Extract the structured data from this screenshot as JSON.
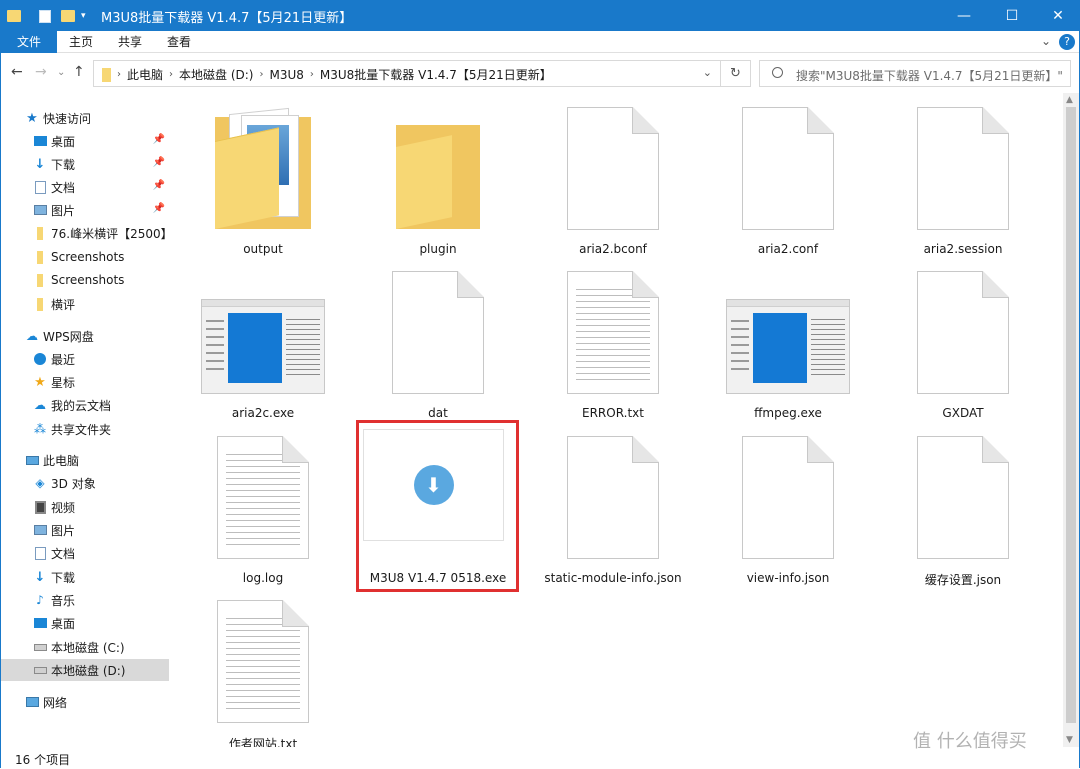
{
  "window": {
    "title": "M3U8批量下载器 V1.4.7【5月21日更新】",
    "controls": {
      "minimize": "—",
      "maximize": "☐",
      "close": "✕"
    }
  },
  "ribbon": {
    "tabs": [
      "文件",
      "主页",
      "共享",
      "查看"
    ],
    "expand_icon": "chevron-down-icon",
    "help_icon": "help-icon"
  },
  "address": {
    "crumbs": [
      "此电脑",
      "本地磁盘 (D:)",
      "M3U8",
      "M3U8批量下载器 V1.4.7【5月21日更新】"
    ],
    "search_placeholder": "搜索\"M3U8批量下载器 V1.4.7【5月21日更新】\""
  },
  "sidebar": {
    "items": [
      {
        "label": "快速访问",
        "icon": "star-icon",
        "pinned": false
      },
      {
        "label": "桌面",
        "icon": "desktop-icon",
        "pinned": true
      },
      {
        "label": "下载",
        "icon": "download-icon",
        "pinned": true
      },
      {
        "label": "文档",
        "icon": "document-icon",
        "pinned": true
      },
      {
        "label": "图片",
        "icon": "pictures-icon",
        "pinned": true
      },
      {
        "label": "76.峰米横评【2500】",
        "icon": "folder-icon",
        "pinned": false
      },
      {
        "label": "Screenshots",
        "icon": "folder-icon",
        "pinned": false
      },
      {
        "label": "Screenshots",
        "icon": "folder-icon",
        "pinned": false
      },
      {
        "label": "横评",
        "icon": "folder-icon",
        "pinned": false
      },
      {
        "label": "WPS网盘",
        "icon": "cloud-icon",
        "pinned": false
      },
      {
        "label": "最近",
        "icon": "clock-icon",
        "pinned": false
      },
      {
        "label": "星标",
        "icon": "star-icon",
        "pinned": false
      },
      {
        "label": "我的云文档",
        "icon": "cloud-icon",
        "pinned": false
      },
      {
        "label": "共享文件夹",
        "icon": "share-icon",
        "pinned": false
      },
      {
        "label": "此电脑",
        "icon": "computer-icon",
        "pinned": false
      },
      {
        "label": "3D 对象",
        "icon": "cube-icon",
        "pinned": false
      },
      {
        "label": "视频",
        "icon": "video-icon",
        "pinned": false
      },
      {
        "label": "图片",
        "icon": "pictures-icon",
        "pinned": false
      },
      {
        "label": "文档",
        "icon": "document-icon",
        "pinned": false
      },
      {
        "label": "下载",
        "icon": "download-icon",
        "pinned": false
      },
      {
        "label": "音乐",
        "icon": "music-icon",
        "pinned": false
      },
      {
        "label": "桌面",
        "icon": "desktop-icon",
        "pinned": false
      },
      {
        "label": "本地磁盘 (C:)",
        "icon": "drive-icon",
        "pinned": false
      },
      {
        "label": "本地磁盘 (D:)",
        "icon": "drive-icon",
        "pinned": false,
        "selected": true
      },
      {
        "label": "网络",
        "icon": "network-icon",
        "pinned": false
      }
    ]
  },
  "files": [
    {
      "name": "output",
      "kind": "folder-docs"
    },
    {
      "name": "plugin",
      "kind": "folder"
    },
    {
      "name": "aria2.bconf",
      "kind": "blank"
    },
    {
      "name": "aria2.conf",
      "kind": "blank"
    },
    {
      "name": "aria2.session",
      "kind": "blank"
    },
    {
      "name": "aria2c.exe",
      "kind": "exe"
    },
    {
      "name": "dat",
      "kind": "blank"
    },
    {
      "name": "ERROR.txt",
      "kind": "text"
    },
    {
      "name": "ffmpeg.exe",
      "kind": "exe"
    },
    {
      "name": "GXDAT",
      "kind": "blank"
    },
    {
      "name": "log.log",
      "kind": "text"
    },
    {
      "name": "M3U8 V1.4.7 0518.exe",
      "kind": "setup",
      "highlighted": true
    },
    {
      "name": "static-module-info.json",
      "kind": "blank"
    },
    {
      "name": "view-info.json",
      "kind": "blank"
    },
    {
      "name": "缓存设置.json",
      "kind": "blank"
    },
    {
      "name": "作者网站.txt",
      "kind": "text"
    }
  ],
  "status": {
    "count_text": "16 个项目"
  },
  "watermark": "值 什么值得买",
  "colors": {
    "accent": "#1979ca",
    "highlight": "#e03030",
    "folder": "#f7d774"
  }
}
